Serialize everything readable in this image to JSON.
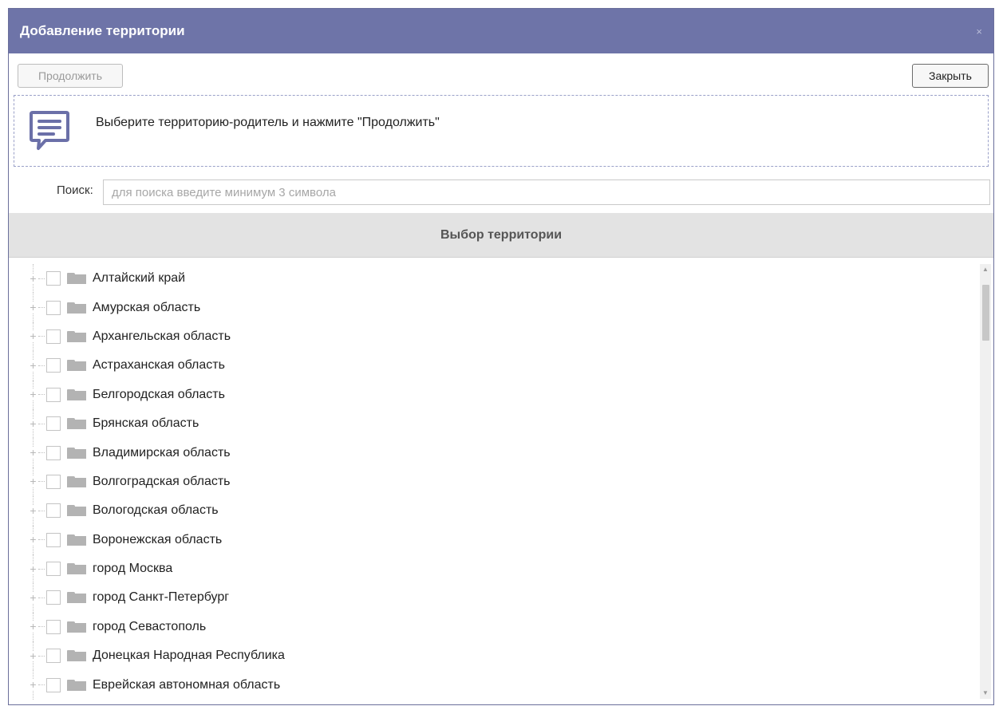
{
  "dialog": {
    "title": "Добавление территории",
    "close_glyph": "×"
  },
  "toolbar": {
    "continue_label": "Продолжить",
    "close_label": "Закрыть"
  },
  "info": {
    "icon": "message-icon",
    "text": "Выберите территорию-родитель и нажмите \"Продолжить\""
  },
  "search": {
    "label": "Поиск:",
    "placeholder": "для поиска введите минимум 3 символа",
    "value": ""
  },
  "tree": {
    "header": "Выбор территории",
    "items": [
      {
        "label": "Алтайский край"
      },
      {
        "label": "Амурская область"
      },
      {
        "label": "Архангельская область"
      },
      {
        "label": "Астраханская область"
      },
      {
        "label": "Белгородская область"
      },
      {
        "label": "Брянская область"
      },
      {
        "label": "Владимирская область"
      },
      {
        "label": "Волгоградская область"
      },
      {
        "label": "Вологодская область"
      },
      {
        "label": "Воронежская область"
      },
      {
        "label": "город Москва"
      },
      {
        "label": "город Санкт-Петербург"
      },
      {
        "label": "город Севастополь"
      },
      {
        "label": "Донецкая Народная Республика"
      },
      {
        "label": "Еврейская автономная область"
      }
    ]
  },
  "colors": {
    "titlebar": "#6e74a8",
    "accent_icon": "#6b70a8",
    "header_bg": "#e3e3e3"
  }
}
